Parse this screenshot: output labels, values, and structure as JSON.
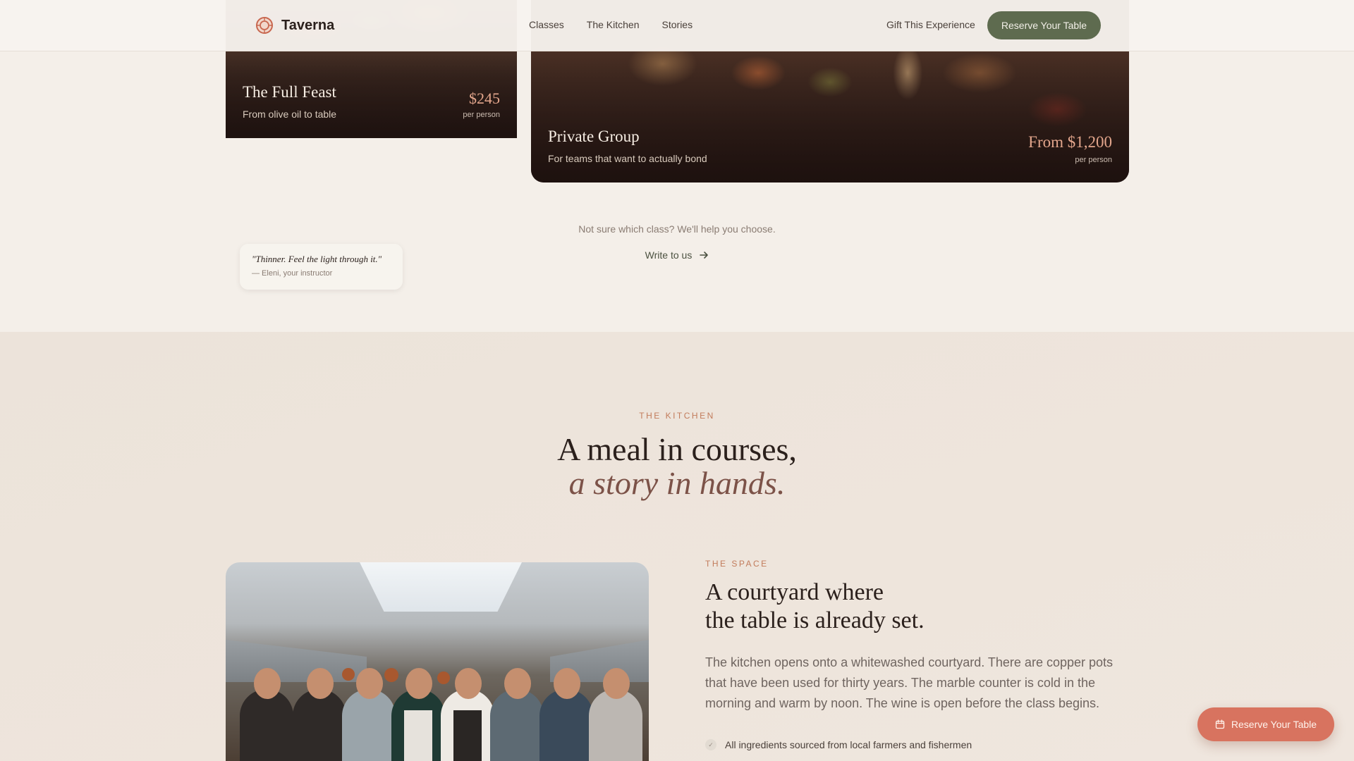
{
  "header": {
    "brand": "Taverna",
    "nav": [
      "Classes",
      "The Kitchen",
      "Stories"
    ],
    "gift_link": "Gift This Experience",
    "reserve_label": "Reserve Your Table"
  },
  "cards": {
    "feast": {
      "title": "The Full Feast",
      "subtitle": "From olive oil to table",
      "price": "$245",
      "per": "per person"
    },
    "group": {
      "title": "Private Group",
      "subtitle": "For teams that want to actually bond",
      "price": "From $1,200",
      "per": "per person"
    }
  },
  "help": {
    "text": "Not sure which class? We'll help you choose.",
    "link": "Write to us"
  },
  "kitchen": {
    "eyebrow": "THE KITCHEN",
    "headline_1": "A meal in courses,",
    "headline_2": "a story in hands.",
    "quote": "\"Thinner. Feel the light through it.\"",
    "quote_author": "— Eleni, your instructor",
    "space_eyebrow": "THE SPACE",
    "space_title_1": "A courtyard where",
    "space_title_2": "the table is already set.",
    "space_body": "The kitchen opens onto a whitewashed courtyard. There are copper pots that have been used for thirty years. The marble counter is cold in the morning and warm by noon. The wine is open before the class begins.",
    "bullet_1": "All ingredients sourced from local farmers and fishermen"
  },
  "float_button": {
    "label": "Reserve Your Table"
  },
  "colors": {
    "accent_green": "#5e6b4f",
    "accent_terracotta": "#d8735f",
    "eyebrow": "#c27c5c",
    "background": "#f4efe9"
  }
}
